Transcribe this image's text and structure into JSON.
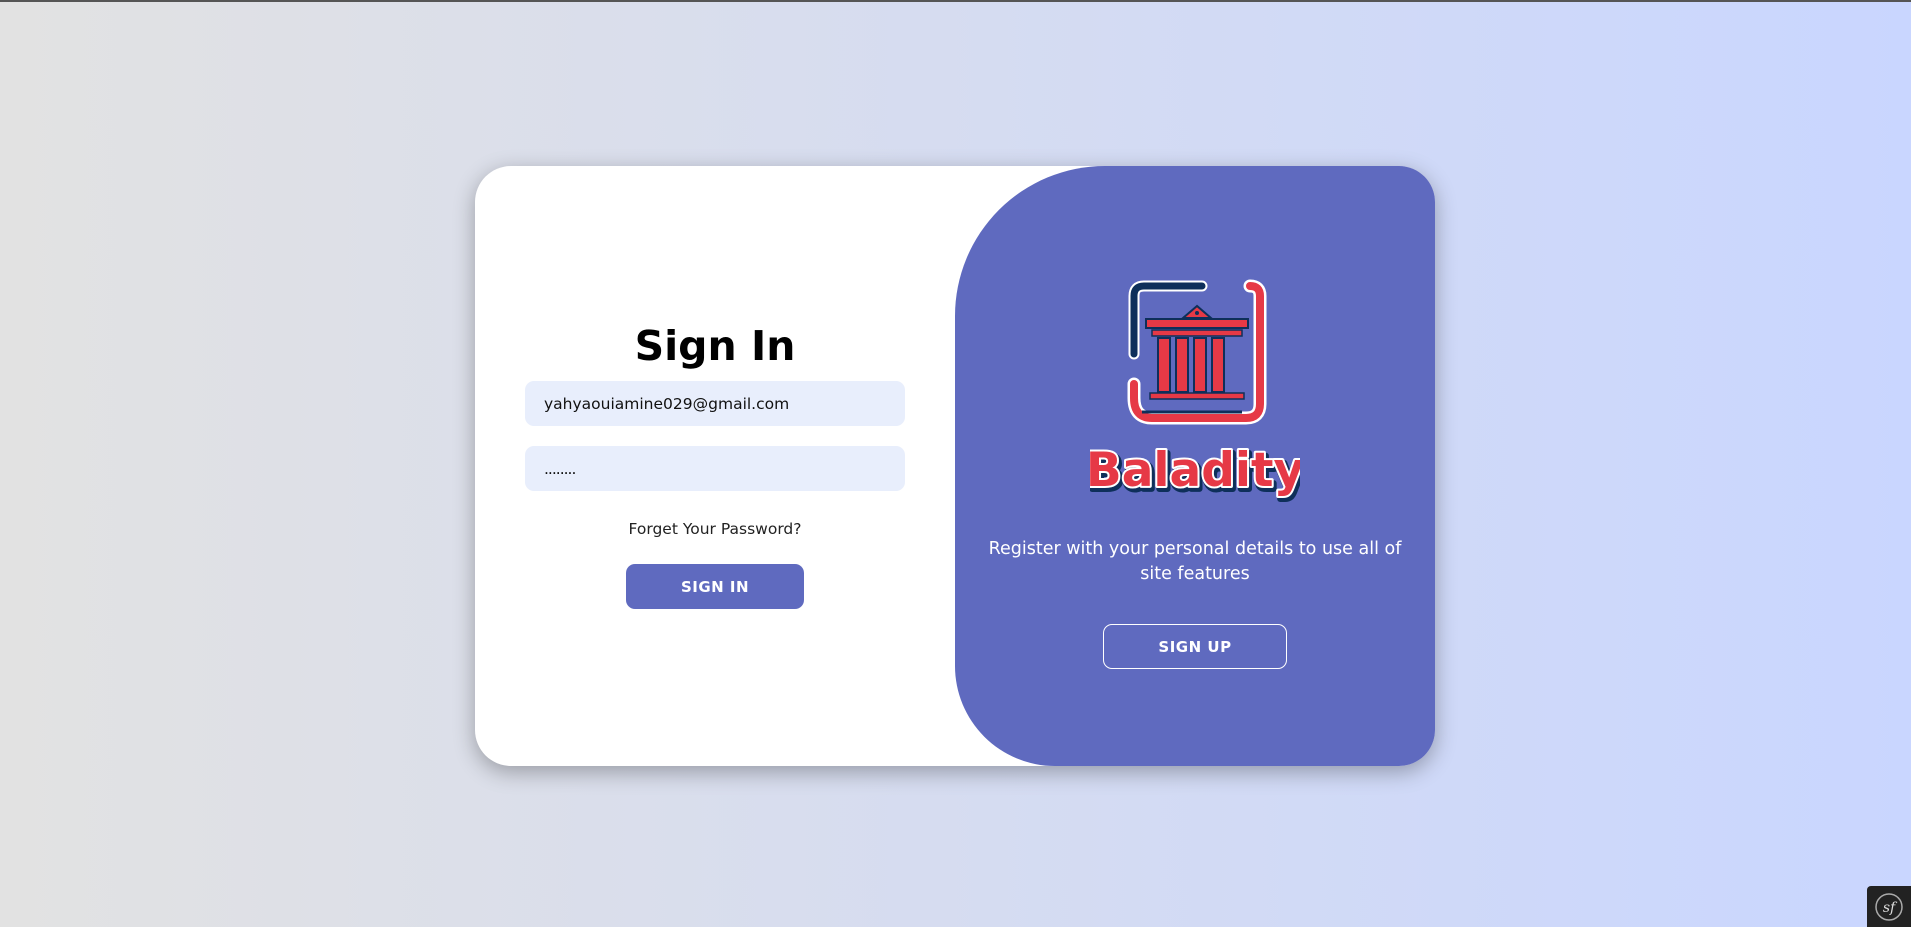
{
  "signin": {
    "title": "Sign In",
    "email_value": "yahyaouiamine029@gmail.com",
    "password_value": "........",
    "forgot_label": "Forget Your Password?",
    "button_label": "SIGN IN"
  },
  "panel": {
    "logo_text": "Baladity",
    "description": "Register with your personal details to use all of site features",
    "button_label": "SIGN UP"
  },
  "toolbar": {
    "label": "sf"
  },
  "colors": {
    "accent": "#5f6abf",
    "logo_red": "#e63946",
    "logo_navy": "#0e2f5a",
    "input_bg": "#e8eefc"
  }
}
